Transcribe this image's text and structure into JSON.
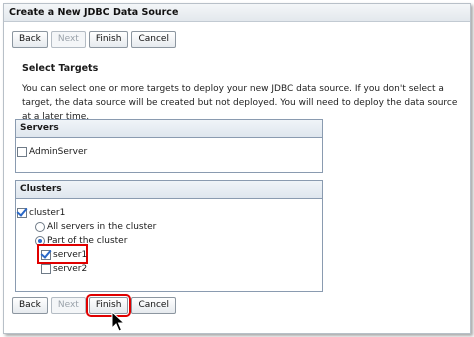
{
  "window": {
    "title": "Create a New JDBC Data Source"
  },
  "buttons": {
    "back": "Back",
    "next": "Next",
    "finish": "Finish",
    "cancel": "Cancel"
  },
  "section": {
    "title": "Select Targets",
    "description": "You can select one or more targets to deploy your new JDBC data source. If you don't select a target, the data source will be created but not deployed. You will need to deploy the data source at a later time."
  },
  "servers": {
    "header": "Servers",
    "items": [
      {
        "label": "AdminServer",
        "checked": false
      }
    ]
  },
  "clusters": {
    "header": "Clusters",
    "cluster": {
      "label": "cluster1",
      "checked": true
    },
    "options": [
      {
        "label": "All servers in the cluster",
        "selected": false
      },
      {
        "label": "Part of the cluster",
        "selected": true
      }
    ],
    "members": [
      {
        "label": "server1",
        "checked": true
      },
      {
        "label": "server2",
        "checked": false
      }
    ]
  },
  "colors": {
    "highlight": "#e00000",
    "check": "#2a68c8"
  }
}
